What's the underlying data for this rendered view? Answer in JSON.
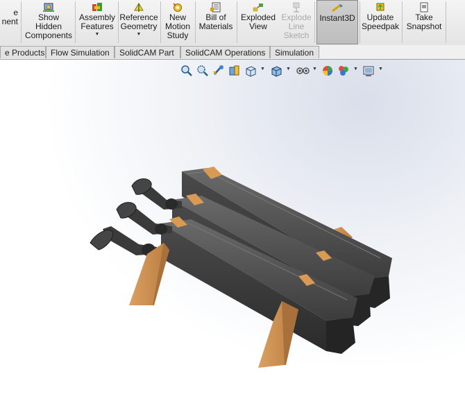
{
  "ribbon": {
    "buttons": [
      {
        "id": "ponent",
        "label": "e\nnent",
        "icon": "component-icon",
        "disabled": false,
        "dropdown": false
      },
      {
        "id": "show-hidden",
        "label": "Show\nHidden\nComponents",
        "icon": "show-hidden-icon",
        "disabled": false,
        "dropdown": false
      },
      {
        "id": "assembly-features",
        "label": "Assembly\nFeatures",
        "icon": "assembly-features-icon",
        "disabled": false,
        "dropdown": true
      },
      {
        "id": "reference-geometry",
        "label": "Reference\nGeometry",
        "icon": "reference-geometry-icon",
        "disabled": false,
        "dropdown": true
      },
      {
        "id": "new-motion-study",
        "label": "New\nMotion\nStudy",
        "icon": "motion-study-icon",
        "disabled": false,
        "dropdown": false
      },
      {
        "id": "bill-of-materials",
        "label": "Bill of\nMaterials",
        "icon": "bom-icon",
        "disabled": false,
        "dropdown": false
      },
      {
        "id": "exploded-view",
        "label": "Exploded\nView",
        "icon": "exploded-view-icon",
        "disabled": false,
        "dropdown": false
      },
      {
        "id": "explode-line-sketch",
        "label": "Explode\nLine\nSketch",
        "icon": "explode-line-icon",
        "disabled": true,
        "dropdown": false
      },
      {
        "id": "instant3d",
        "label": "Instant3D",
        "icon": "instant3d-icon",
        "disabled": false,
        "dropdown": false,
        "active": true
      },
      {
        "id": "update-speedpak",
        "label": "Update\nSpeedpak",
        "icon": "speedpak-icon",
        "disabled": false,
        "dropdown": false
      },
      {
        "id": "take-snapshot",
        "label": "Take\nSnapshot",
        "icon": "snapshot-icon",
        "disabled": false,
        "dropdown": false
      }
    ]
  },
  "tabs": [
    "e Products",
    "Flow Simulation",
    "SolidCAM Part",
    "SolidCAM Operations",
    "Simulation"
  ],
  "heads_up_toolbar": [
    "zoom-to-fit-icon",
    "zoom-area-icon",
    "previous-view-icon",
    "section-view-icon",
    "view-orientation-icon",
    "display-style-icon",
    "hide-show-items-icon",
    "edit-appearance-icon",
    "apply-scene-icon",
    "view-settings-icon"
  ],
  "colors": {
    "ribbon_bg": "#ececec",
    "block_body": "#4a4a4a",
    "wood": "#c99150",
    "accent_yellow": "#f2c200"
  }
}
